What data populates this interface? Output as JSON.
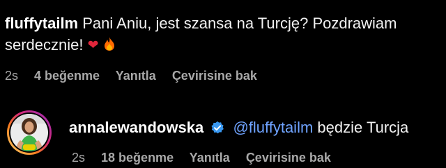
{
  "comments": [
    {
      "username": "fluffytailm",
      "text": "Pani Aniu, jest szansa na Turcję? Pozdrawiam serdecznie!",
      "emojis": [
        "❤",
        "🔥"
      ],
      "time": "2s",
      "likes": "4 beğenme",
      "reply": "Yanıtla",
      "translate": "Çevirisine bak"
    },
    {
      "username": "annalewandowska",
      "verified": true,
      "mention": "@fluffytailm",
      "text": "będzie Turcja",
      "time": "2s",
      "likes": "18 beğenme",
      "reply": "Yanıtla",
      "translate": "Çevirisine bak"
    }
  ],
  "colors": {
    "background": "#000000",
    "mention": "#6fa3ff",
    "verified": "#3897f0",
    "meta": "#a8a8a8",
    "avatar_ring": "#d6249f"
  },
  "icons": {
    "verified": "verified-badge-icon",
    "heart": "red-heart-icon",
    "fire": "fire-icon"
  }
}
